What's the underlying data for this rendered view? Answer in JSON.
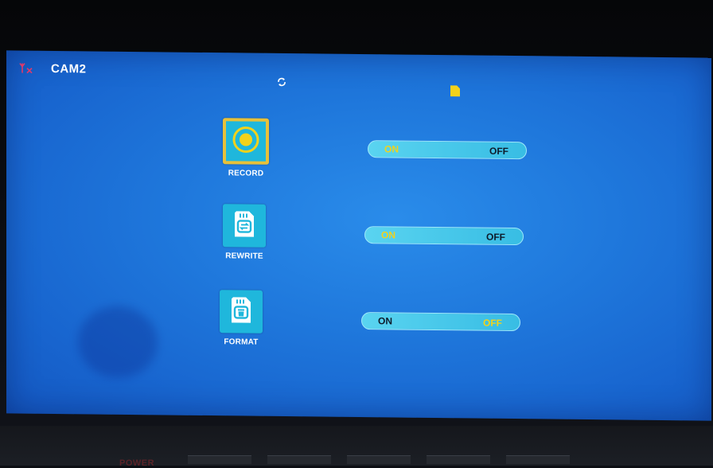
{
  "topbar": {
    "camera_label": "CAM2",
    "signal_icon": "no-signal-antenna-icon",
    "cycle_icon": "loop-record-icon",
    "file_icon": "sd-file-icon"
  },
  "menu": [
    {
      "label": "RECORD",
      "icon": "record-icon",
      "selected": true,
      "toggle": {
        "on": "ON",
        "off": "OFF",
        "state": "on"
      }
    },
    {
      "label": "REWRITE",
      "icon": "sd-rewrite-icon",
      "selected": false,
      "toggle": {
        "on": "ON",
        "off": "OFF",
        "state": "on"
      }
    },
    {
      "label": "FORMAT",
      "icon": "sd-format-icon",
      "selected": false,
      "toggle": {
        "on": "ON",
        "off": "OFF",
        "state": "off"
      }
    }
  ],
  "hardware": {
    "power_label": "POWER"
  },
  "colors": {
    "screen_blue": "#1f78dc",
    "tile_cyan": "#1fb7dc",
    "highlight_yellow": "#f2d21a"
  }
}
